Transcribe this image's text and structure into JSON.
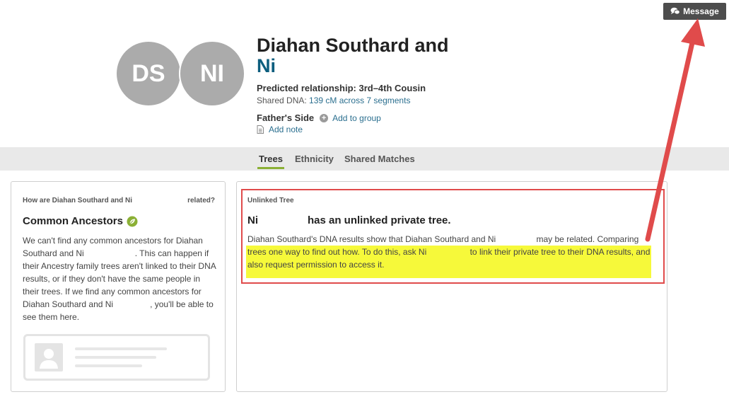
{
  "header": {
    "message_button": "Message"
  },
  "profile": {
    "avatars": [
      "DS",
      "NI"
    ],
    "name_line1": "Diahan Southard and",
    "name_line2": "Ni",
    "predicted_relationship": "Predicted relationship: 3rd–4th Cousin",
    "shared_dna_label": "Shared DNA:",
    "shared_dna_value": "139 cM across 7 segments",
    "side": "Father's Side",
    "add_group": "Add to group",
    "add_note": "Add note"
  },
  "tabs": [
    {
      "label": "Trees",
      "active": true
    },
    {
      "label": "Ethnicity",
      "active": false
    },
    {
      "label": "Shared Matches",
      "active": false
    }
  ],
  "left_card": {
    "question_part1": "How are Diahan Southard and Ni",
    "question_part2": "related?",
    "title": "Common Ancestors",
    "body_p1": "We can't find any common ancestors for Diahan Southard and Ni",
    "body_p2": ". This can happen if their Ancestry family trees aren't linked to their DNA results, or if they don't have the same people in their trees.  If we find any common ancestors for Diahan Southard and Ni",
    "body_p3": ", you'll be able to see them here."
  },
  "right_card": {
    "label": "Unlinked Tree",
    "title_name": "Ni",
    "title_rest": "has an unlinked private tree.",
    "body_p1": "Diahan Southard's DNA results show that Diahan Southard and Ni",
    "body_p2": " may be related. Comparing trees one way to find out how. To do this, ask Ni",
    "body_p3": " to link their private tree to their DNA results, and also request permission to access it."
  },
  "colors": {
    "accent_tab": "#8bb035",
    "link": "#2b6f8f",
    "name_blue": "#0d5e7e",
    "annotation_red": "#e04b4b",
    "highlight_yellow": "#f6f93a"
  }
}
